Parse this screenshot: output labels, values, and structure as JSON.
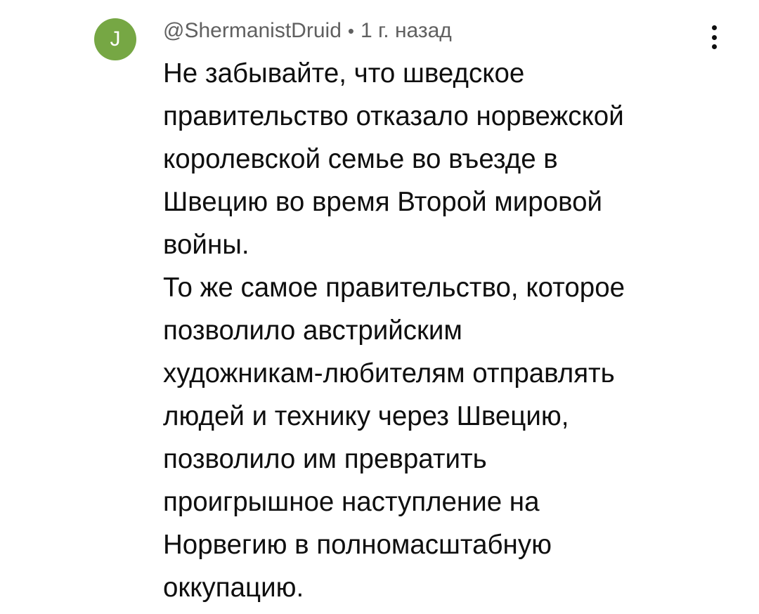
{
  "comment": {
    "avatar_letter": "J",
    "avatar_color": "#76a744",
    "author": "@ShermanistDruid",
    "separator": "•",
    "time": "1 г. назад",
    "menu_icon": "more-vert-icon",
    "lines": [
      "Не забывайте, что шведское",
      "правительство отказало норвежской",
      "королевской семье во въезде в",
      "Швецию во время Второй мировой",
      "войны.",
      "То же самое правительство, которое",
      "позволило австрийским",
      "художникам-любителям отправлять",
      "людей и технику через Швецию,",
      "позволило им превратить",
      "проигрышное наступление на",
      "Норвегию в полномасштабную",
      "оккупацию."
    ]
  }
}
